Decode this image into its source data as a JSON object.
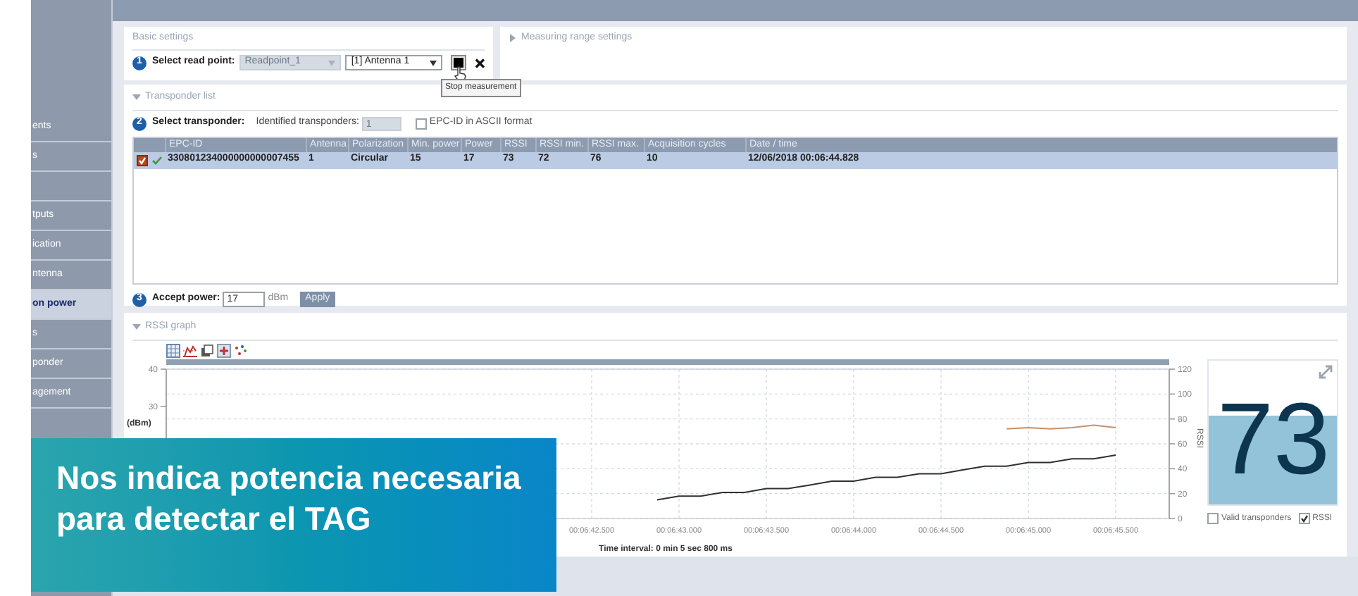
{
  "sidebar": {
    "items": [
      {
        "kind": "link",
        "label": "ents",
        "selected": false
      },
      {
        "kind": "link",
        "label": "s",
        "selected": false
      },
      {
        "kind": "blank",
        "selected": false
      },
      {
        "kind": "link",
        "label": "tputs",
        "selected": false
      },
      {
        "kind": "link",
        "label": "ication",
        "selected": false
      },
      {
        "kind": "link",
        "label": "ntenna",
        "selected": false
      },
      {
        "kind": "link",
        "label": "on power",
        "selected": true
      },
      {
        "kind": "link",
        "label": "s",
        "selected": false
      },
      {
        "kind": "link",
        "label": "ponder",
        "selected": false
      },
      {
        "kind": "link",
        "label": "agement",
        "selected": false
      }
    ]
  },
  "basic_settings": {
    "title": "Basic settings",
    "step": "1",
    "label": "Select read point:",
    "read_point": {
      "value": "Readpoint_1",
      "disabled": true
    },
    "antenna": {
      "value": "[1] Antenna 1"
    },
    "tooltip": "Stop measurement"
  },
  "measuring_range": {
    "title": "Measuring range settings",
    "expanded": false
  },
  "transponder_list": {
    "title": "Transponder list",
    "expanded": true,
    "step": "2",
    "label": "Select transponder:",
    "identified_label": "Identified transponders:",
    "identified_count": "1",
    "epc_ascii": {
      "label": "EPC-ID in ASCII format",
      "checked": false
    },
    "table": {
      "columns": [
        "EPC-ID",
        "Antenna",
        "Polarization",
        "Min. power",
        "Power",
        "RSSI",
        "RSSI min.",
        "RSSI max.",
        "Acquisition cycles",
        "Date / time"
      ],
      "rows": [
        {
          "checked": true,
          "valid": true,
          "selected": true,
          "cells": [
            "330801234000000000007455",
            "1",
            "Circular",
            "15",
            "17",
            "73",
            "72",
            "76",
            "10",
            "12/06/2018 00:06:44.828"
          ]
        }
      ]
    }
  },
  "accept_power": {
    "step": "3",
    "label": "Accept power:",
    "value": "17",
    "unit": "dBm",
    "button": "Apply"
  },
  "rssi_graph": {
    "title": "RSSI graph",
    "expanded": true,
    "time_interval": "Time interval: 0 min 5 sec 800 ms",
    "left_axis_ticks": [
      "40",
      "30"
    ],
    "left_axis_label": "(dBm)",
    "chart_data": {
      "type": "line",
      "ylabel": "RSSI",
      "ylim": [
        0,
        120
      ],
      "grid": true,
      "categories": [
        "00:06:42.500",
        null,
        null,
        null,
        "00:06:43.000",
        null,
        null,
        null,
        "00:06:43.500",
        null,
        null,
        null,
        "00:06:44.000",
        null,
        null,
        null,
        "00:06:44.500",
        null,
        null,
        null,
        "00:06:45.000",
        null,
        null,
        null,
        "00:06:45.500"
      ],
      "yticks": [
        0,
        20,
        40,
        60,
        80,
        100,
        120
      ],
      "series": [
        {
          "color": "#303030",
          "values": [
            null,
            null,
            null,
            15,
            18,
            18,
            21,
            21,
            24,
            24,
            27,
            30,
            30,
            33,
            33,
            36,
            36,
            39,
            42,
            42,
            45,
            45,
            48,
            48,
            51
          ]
        },
        {
          "color": "#c8906a",
          "values": [
            null,
            null,
            null,
            null,
            null,
            null,
            null,
            null,
            null,
            null,
            null,
            null,
            null,
            null,
            null,
            null,
            null,
            null,
            null,
            72,
            73,
            72,
            73,
            75,
            73
          ]
        }
      ]
    },
    "current_value": {
      "value": "73",
      "level": 0.61
    },
    "options": [
      {
        "label": "Valid transponders",
        "checked": false
      },
      {
        "label": "RSSI",
        "checked": true
      }
    ]
  },
  "caption": {
    "text": "Nos indica potencia necesaria para detectar el TAG"
  }
}
